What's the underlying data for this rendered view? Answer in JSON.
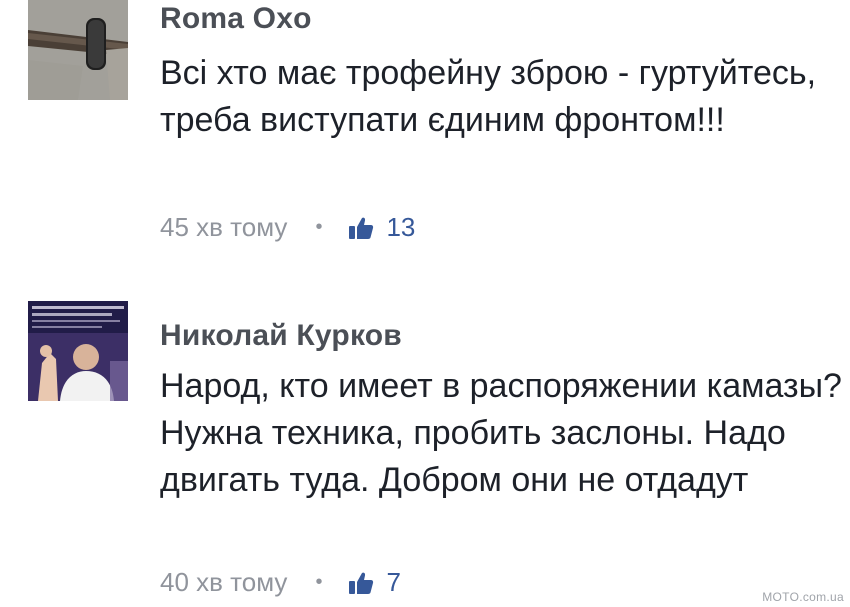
{
  "comments": [
    {
      "author": "Roma Oxo",
      "text": "Всі хто має трофейну зброю - гуртуйтесь, треба виступати єдиним фронтом!!!",
      "time": "45 хв тому",
      "separator": "•",
      "likes": "13",
      "avatar": "knife-photo-avatar"
    },
    {
      "author": "Николай Курков",
      "text": "Народ, кто имеет в распоряжении камазы? Нужна техника, пробить заслоны. Надо двигать туда. Добром они не отдадут",
      "time": "40 хв тому",
      "separator": "•",
      "likes": "7",
      "avatar": "politician-photo-avatar"
    }
  ],
  "icons": {
    "like": "thumbs-up-icon",
    "separator": "dot-icon"
  },
  "colors": {
    "author": "#4b4f56",
    "text": "#1d2129",
    "meta": "#90949c",
    "like": "#365899"
  },
  "watermark": "MOTO.com.ua"
}
